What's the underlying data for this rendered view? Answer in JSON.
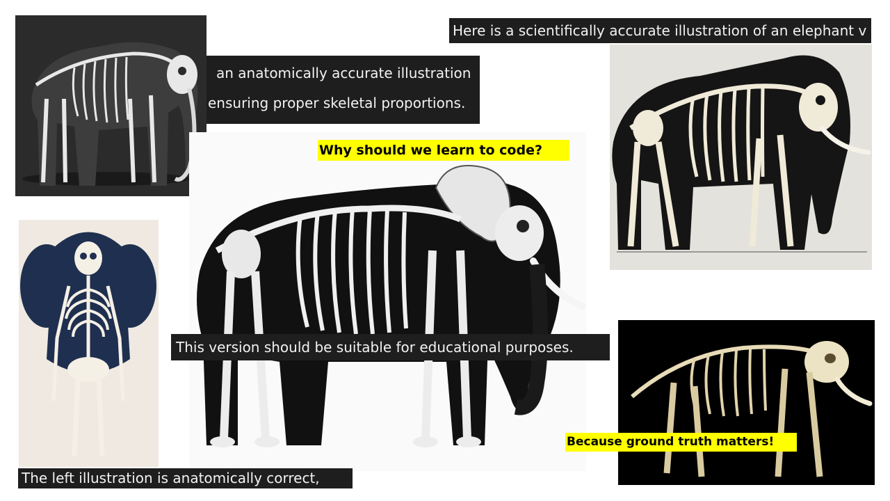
{
  "slide": {
    "background": "#ffffff",
    "captions": {
      "top_right": "Here is a scientifically accurate illustration of an elephant v",
      "top_middle_line1": "an anatomically accurate illustration",
      "top_middle_line2": "ensuring proper skeletal proportions.",
      "question": "Why should we learn to code?",
      "center": "This version should be suitable for educational purposes.",
      "bottom_left": "The left illustration is anatomically correct,",
      "answer": "Because ground truth matters!"
    },
    "colors": {
      "caption_background": "#1e1e1e",
      "caption_text": "#f2f2f2",
      "highlight": "#ffff00",
      "highlight_text": "#000000"
    }
  }
}
